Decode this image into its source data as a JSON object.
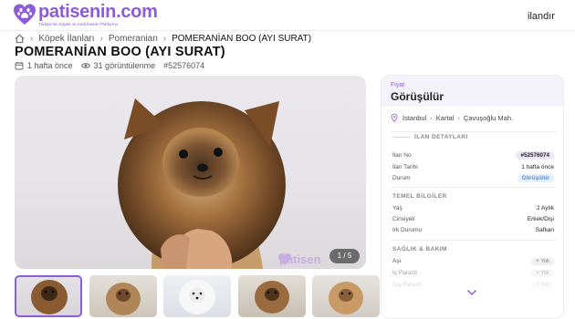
{
  "header": {
    "logo_name": "patisenin.com",
    "logo_tagline": "Türkiye'nin Köpek ve Kedi İlanları Platformu",
    "nav_ilanlar": "ilandır"
  },
  "breadcrumb": [
    "Köpek İlanları",
    "Pomeranian",
    "POMERANİAN BOO (AYI SURAT)"
  ],
  "listing": {
    "title": "POMERANİAN BOO (AYI SURAT)",
    "posted": "1 hafta önce",
    "views": "31 görüntülenme",
    "id": "#52576074"
  },
  "gallery": {
    "counter": "1 / 5",
    "watermark": "patisen"
  },
  "panel": {
    "price_label": "Fiyat",
    "price_value": "Görüşülür",
    "location": [
      "İstanbul",
      "Kartal",
      "Çavuşoğlu Mah."
    ],
    "details_heading": "İLAN DETAYLARI",
    "details": [
      {
        "key": "İlan No",
        "value": "#52576074"
      },
      {
        "key": "İlan Tarihi",
        "value": "1 hafta önce"
      },
      {
        "key": "Durum",
        "value": "Görüşülür"
      }
    ],
    "basic_heading": "TEMEL BİLGİLER",
    "basic": [
      {
        "key": "Yaş",
        "value": "2 Aylık"
      },
      {
        "key": "Cinsiyeti",
        "value": "Erkek/Dişi"
      },
      {
        "key": "Irk Durumu",
        "value": "Safkan"
      }
    ],
    "health_heading": "SAĞLIK & BAKIM",
    "health": [
      {
        "key": "Aşı",
        "value": "× Yok"
      },
      {
        "key": "İç Parazit",
        "value": "× Yok"
      },
      {
        "key": "Dış Parazit",
        "value": "× Yok"
      }
    ]
  },
  "colors": {
    "brand": "#8e5bd9",
    "price_bg": "#f4f2fa"
  }
}
